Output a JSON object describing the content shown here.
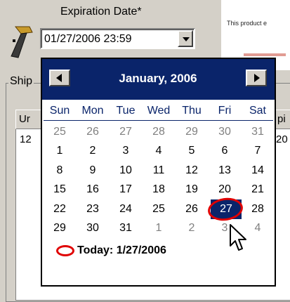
{
  "form": {
    "expiration_label": "Expiration Date*",
    "date_value": "01/27/2006 23:59",
    "notice_text": "This product e",
    "shipment_legend": "Ship",
    "grid_col_left": "Ur",
    "grid_col_right": "pi",
    "grid_cell_left": "12",
    "grid_cell_right": "20"
  },
  "calendar": {
    "month_title": "January, 2006",
    "days_of_week": [
      "Sun",
      "Mon",
      "Tue",
      "Wed",
      "Thu",
      "Fri",
      "Sat"
    ],
    "weeks": [
      [
        "25",
        "26",
        "27",
        "28",
        "29",
        "30",
        "31"
      ],
      [
        "1",
        "2",
        "3",
        "4",
        "5",
        "6",
        "7"
      ],
      [
        "8",
        "9",
        "10",
        "11",
        "12",
        "13",
        "14"
      ],
      [
        "15",
        "16",
        "17",
        "18",
        "19",
        "20",
        "21"
      ],
      [
        "22",
        "23",
        "24",
        "25",
        "26",
        "27",
        "28"
      ],
      [
        "29",
        "30",
        "31",
        "1",
        "2",
        "3",
        "4"
      ]
    ],
    "today_text": "Today: 1/27/2006",
    "selected_day": "27"
  },
  "colors": {
    "header_bg": "#0a246a",
    "annotation_red": "#e00000",
    "window_bg": "#d4d0c8"
  },
  "icons": {
    "barcode_scanner": "barcode-scanner-icon",
    "prev": "triangle-left-icon",
    "next": "triangle-right-icon",
    "dropdown": "chevron-down-icon",
    "cursor": "mouse-pointer-icon"
  }
}
